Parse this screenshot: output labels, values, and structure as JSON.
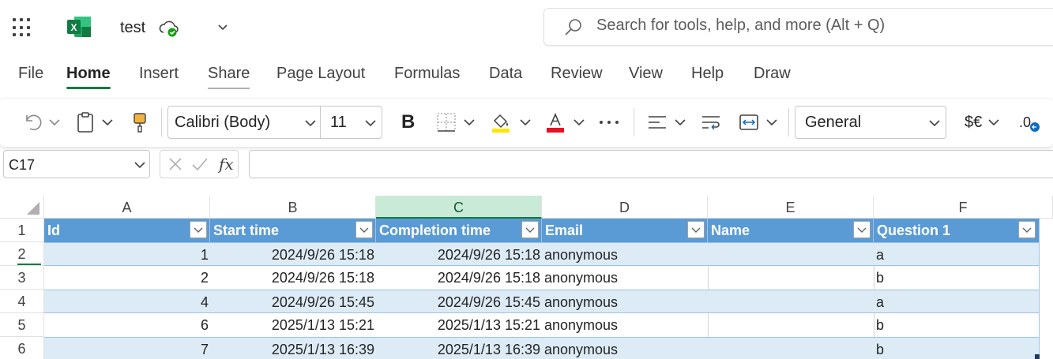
{
  "app": {
    "doc_title": "test",
    "search_placeholder": "Search for tools, help, and more (Alt + Q)"
  },
  "menu_tabs": [
    {
      "label": "File"
    },
    {
      "label": "Home"
    },
    {
      "label": "Insert"
    },
    {
      "label": "Share"
    },
    {
      "label": "Page Layout"
    },
    {
      "label": "Formulas"
    },
    {
      "label": "Data"
    },
    {
      "label": "Review"
    },
    {
      "label": "View"
    },
    {
      "label": "Help"
    },
    {
      "label": "Draw"
    }
  ],
  "active_tab": "Home",
  "ribbon": {
    "font_name": "Calibri (Body)",
    "font_size": "11",
    "bold_label": "B",
    "number_format": "General",
    "currency_label": "$€",
    "decimal_label": ".0"
  },
  "formula_bar": {
    "name_box": "C17",
    "fx_label": "fx",
    "formula": ""
  },
  "sheet": {
    "columns": [
      "A",
      "B",
      "C",
      "D",
      "E",
      "F"
    ],
    "selected_column": "C",
    "row_numbers": [
      "1",
      "2",
      "3",
      "4",
      "5",
      "6"
    ],
    "table_headers": [
      "Id",
      "Start time",
      "Completion time",
      "Email",
      "Name",
      "Question 1"
    ],
    "rows": [
      {
        "id": "1",
        "start": "2024/9/26 15:18",
        "completion": "2024/9/26 15:18",
        "email": "anonymous",
        "name": "",
        "q1": "a"
      },
      {
        "id": "2",
        "start": "2024/9/26 15:18",
        "completion": "2024/9/26 15:18",
        "email": "anonymous",
        "name": "",
        "q1": "b"
      },
      {
        "id": "4",
        "start": "2024/9/26 15:45",
        "completion": "2024/9/26 15:45",
        "email": "anonymous",
        "name": "",
        "q1": "a"
      },
      {
        "id": "6",
        "start": "2025/1/13 15:21",
        "completion": "2025/1/13 15:21",
        "email": "anonymous",
        "name": "",
        "q1": "b"
      },
      {
        "id": "7",
        "start": "2025/1/13 16:39",
        "completion": "2025/1/13 16:39",
        "email": "anonymous",
        "name": "",
        "q1": "b"
      }
    ]
  },
  "colors": {
    "accent": "#107c41",
    "table_header": "#5b9bd5",
    "table_band": "#ddebf7"
  }
}
